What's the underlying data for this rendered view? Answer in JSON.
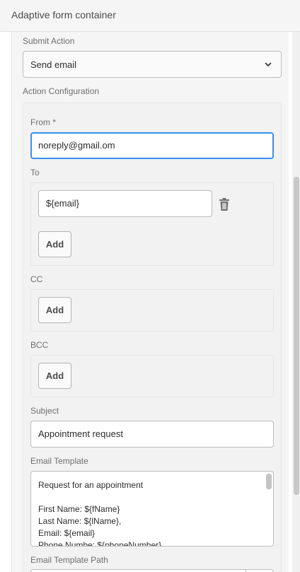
{
  "header": {
    "title": "Adaptive form container"
  },
  "submit_action": {
    "label": "Submit Action",
    "selected": "Send email"
  },
  "action_config": {
    "label": "Action Configuration",
    "from": {
      "label": "From *",
      "value": "noreply@gmail.om"
    },
    "to": {
      "label": "To",
      "value": "${email}",
      "add_label": "Add"
    },
    "cc": {
      "label": "CC",
      "add_label": "Add"
    },
    "bcc": {
      "label": "BCC",
      "add_label": "Add"
    },
    "subject": {
      "label": "Subject",
      "value": "Appointment request"
    },
    "email_template": {
      "label": "Email Template",
      "lines": [
        "Request for an appointment",
        "",
        "First Name: ${fName}",
        "Last Name: ${lName},",
        "Email: ${email}",
        "Phone Numbe: ${phoneNumber}"
      ]
    },
    "email_template_path": {
      "label": "Email Template Path",
      "value": ""
    }
  },
  "colors": {
    "focus": "#378ef0",
    "panel": "#f5f5f5",
    "border": "#bcbcbc"
  },
  "icons": {
    "chevron": "chevron-down-icon",
    "delete": "trash-icon"
  }
}
